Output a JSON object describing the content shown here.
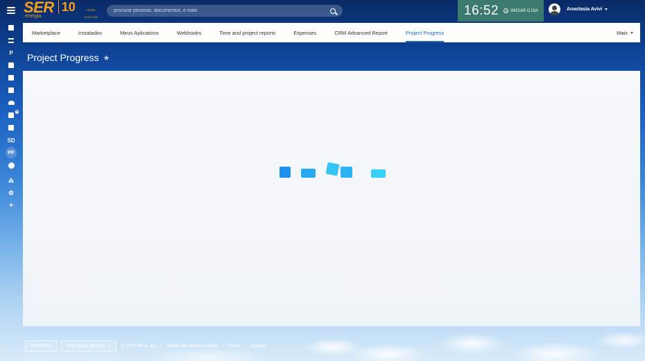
{
  "logo": {
    "brand": "SER",
    "sub": "energia",
    "anniversary": "10",
    "years_label": "YEARS",
    "range": "2010-2020"
  },
  "search": {
    "placeholder": "procurar pessoas, documentos, e mais"
  },
  "clock": {
    "time": "16:52",
    "start_day_label": "INICIAR O DIA"
  },
  "user": {
    "name": "Anastasia Avivi"
  },
  "sidebar": {
    "items": [
      {
        "icon": "feed-icon"
      },
      {
        "icon": "filter-icon"
      },
      {
        "icon": "p-icon",
        "label": "P"
      },
      {
        "icon": "mail-icon"
      },
      {
        "icon": "task-icon"
      },
      {
        "icon": "drive-icon"
      },
      {
        "icon": "people-icon"
      },
      {
        "icon": "chat-icon",
        "counter": "0"
      },
      {
        "icon": "calendar-icon"
      },
      {
        "icon": "sd-icon",
        "label": "SD"
      },
      {
        "icon": "pp-icon",
        "label": "PP"
      },
      {
        "icon": "minus-circle-icon"
      },
      {
        "icon": "sitemap-icon"
      },
      {
        "icon": "gear-icon"
      },
      {
        "icon": "plus-icon"
      }
    ]
  },
  "nav": {
    "tabs": [
      {
        "label": "Marketplace"
      },
      {
        "label": "Instalados"
      },
      {
        "label": "Meus Aplicativos"
      },
      {
        "label": "Webhooks"
      },
      {
        "label": "Time and project reports"
      },
      {
        "label": "Expenses"
      },
      {
        "label": "CRM Advanced Report"
      },
      {
        "label": "Project Progress",
        "active": true
      }
    ],
    "more_label": "Mais"
  },
  "page": {
    "title": "Project Progress"
  },
  "loader": {
    "colors": [
      "#1e90f0",
      "#27aaf2",
      "#34c5f5",
      "#2cb3f3",
      "#38d0f5"
    ]
  },
  "footer": {
    "bitrix_label": "Bitrix24©",
    "language": "Português (Brasil)",
    "copyright": "© 2020 Bitrix, Inc.",
    "implementation": "Pedido de implementação",
    "themes": "Temas",
    "print": "Imprimir"
  }
}
